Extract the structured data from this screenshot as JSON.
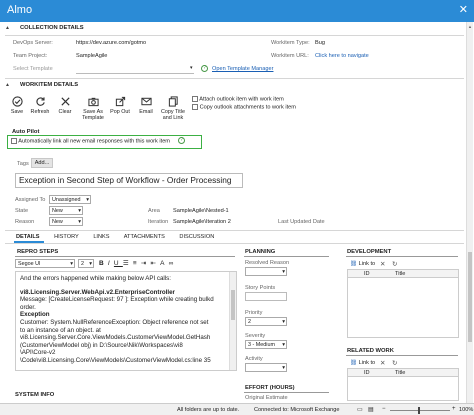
{
  "app": {
    "title": "Almo",
    "close": "✕"
  },
  "collection": {
    "header": "COLLECTION DETAILS",
    "server_label": "DevOps Server:",
    "server_value": "https://dev.azure.com/gotmo",
    "project_label": "Team Project:",
    "project_value": "SampleAgile",
    "template_label": "Select Template",
    "template_link": "Open Template Manager",
    "wit_type_label": "Workitem Type:",
    "wit_type_value": "Bug",
    "wit_url_label": "Workitem URL:",
    "wit_url_link": "Click here to navigate"
  },
  "workitem": {
    "header": "WORKITEM DETAILS",
    "toolbar": {
      "save": "Save",
      "refresh": "Refresh",
      "clear": "Clear",
      "save_template": "Save As Template",
      "pop_out": "Pop Out",
      "email": "Email",
      "copy_title": "Copy Title and Link"
    },
    "attach_outlook": "Attach outlook item with work item",
    "copy_attachments": "Copy outlook attachments to work item",
    "autopilot_label": "Auto Pilot",
    "autopilot_option": "Automatically link all new email responses with this work item",
    "tags_label": "Tags",
    "tags_add": "Add...",
    "title_value": "Exception in Second Step of Workflow - Order Processing",
    "assigned_label": "Assigned To",
    "assigned_value": "Unassigned",
    "state_label": "State",
    "state_value": "New",
    "reason_label": "Reason",
    "reason_value": "New",
    "area_label": "Area",
    "area_value": "SampleAgile\\Nested-1",
    "iteration_label": "Iteration",
    "iteration_value": "SampleAgile\\Iteration 2",
    "last_updated_label": "Last Updated Date",
    "tabs": [
      "DETAILS",
      "HISTORY",
      "LINKS",
      "ATTACHMENTS",
      "DISCUSSION"
    ]
  },
  "repro": {
    "header": "REPRO STEPS",
    "font_name": "Segoe UI",
    "font_size": "2",
    "lines": [
      "And the errors happened while making below API calls:",
      "vi8.Licensing.Server.WebApi.v2.EnterpriseController",
      "Message: [CreateLicenseRequest: 97 ]: Exception while creating bulkd",
      "order.",
      "Exception",
      "Customer: System.NullReferenceException: Object reference not set",
      "to an instance of an object.    at",
      "vi8.Licensing.Server.Core.ViewModels.CustomerViewModel.GetHash",
      "(CustomerViewModel obj) in D:\\Source\\Nik\\Workspaces\\vi8",
      "\\API\\Core-v2",
      "\\Code\\vi8.Licensing.Core\\ViewModels\\CustomerViewModel.cs:line 35"
    ],
    "system_info": "SYSTEM INFO"
  },
  "planning": {
    "header": "PLANNING",
    "resolved_reason": "Resolved Reason",
    "story_points": "Story Points",
    "priority_label": "Priority",
    "priority_value": "2",
    "severity_label": "Severity",
    "severity_value": "3 - Medium",
    "activity_label": "Activity",
    "effort_header": "EFFORT (HOURS)",
    "original_estimate": "Original Estimate"
  },
  "development": {
    "header": "DEVELOPMENT",
    "link_to": "Link to",
    "col_id": "ID",
    "col_title": "Title"
  },
  "related": {
    "header": "RELATED WORK",
    "link_to": "Link to",
    "col_id": "ID",
    "col_title": "Title"
  },
  "statusbar": {
    "folders": "All folders are up to date.",
    "connection": "Connected to: Microsoft Exchange",
    "zoom": "100%"
  },
  "colors": {
    "titlebar": "#2b8bd6",
    "autopilot_border": "#3cb043",
    "link": "#1a5fb4"
  }
}
